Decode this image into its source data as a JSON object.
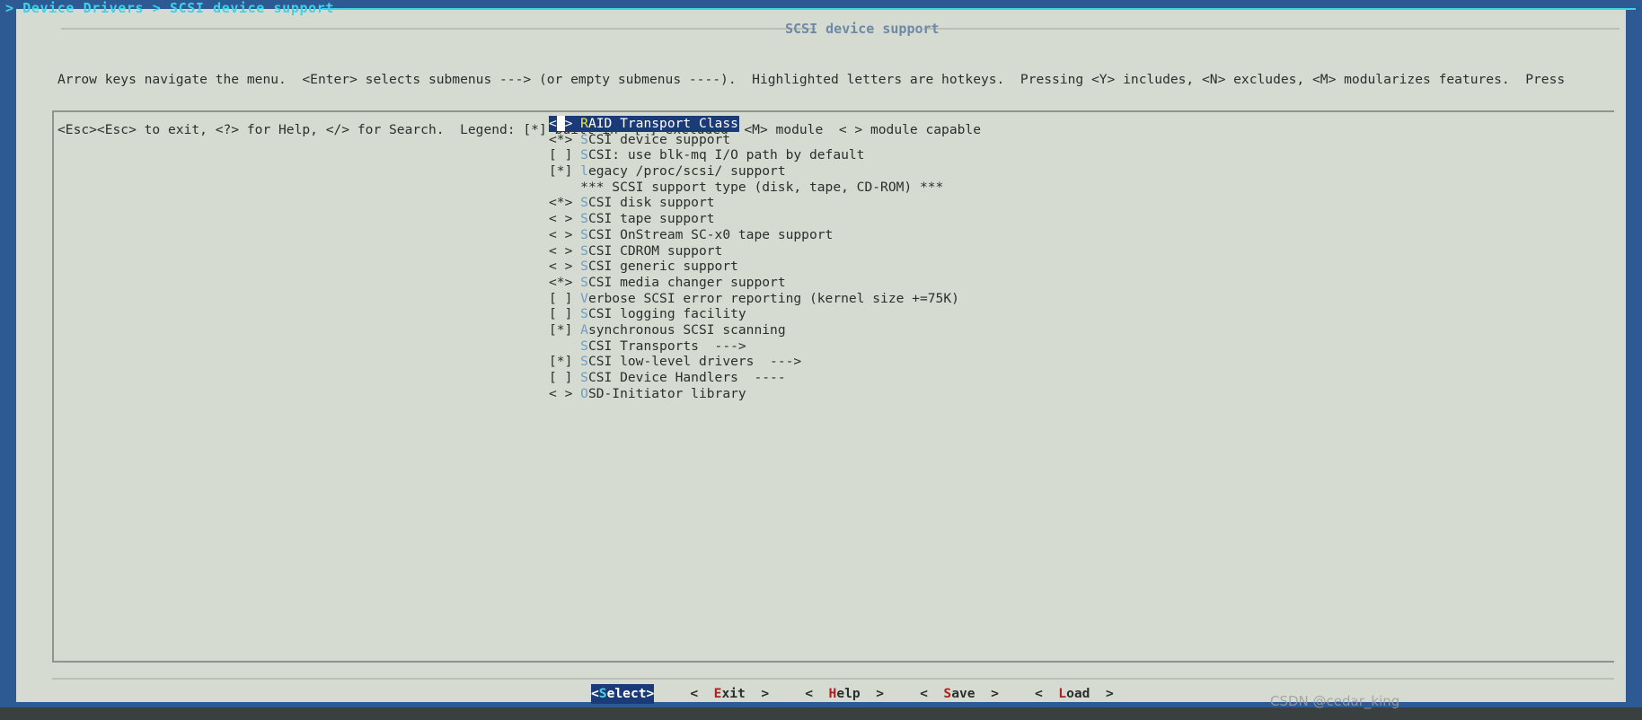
{
  "window": {
    "breadcrumb": "> Device Drivers > SCSI device support",
    "dialog_title": "SCSI device support"
  },
  "help": {
    "line1": "Arrow keys navigate the menu.  <Enter> selects submenus ---> (or empty submenus ----).  Highlighted letters are hotkeys.  Pressing <Y> includes, <N> excludes, <M> modularizes features.  Press",
    "line2": "<Esc><Esc> to exit, <?> for Help, </> for Search.  Legend: [*] built-in  [ ] excluded  <M> module  < > module capable"
  },
  "menu": {
    "selected_index": 0,
    "items": [
      {
        "state": "< >",
        "hotkey": "R",
        "rest": "AID Transport Class",
        "selected": true,
        "type": "tristate"
      },
      {
        "state": "<*>",
        "hotkey": "S",
        "rest": "CSI device support",
        "selected": false,
        "type": "tristate"
      },
      {
        "state": "[ ]",
        "hotkey": "S",
        "rest": "CSI: use blk-mq I/O path by default",
        "selected": false,
        "type": "bool"
      },
      {
        "state": "[*]",
        "hotkey": "l",
        "rest": "egacy /proc/scsi/ support",
        "selected": false,
        "type": "bool"
      },
      {
        "state": "   ",
        "hotkey": "",
        "rest": "*** SCSI support type (disk, tape, CD-ROM) ***",
        "selected": false,
        "type": "comment"
      },
      {
        "state": "<*>",
        "hotkey": "S",
        "rest": "CSI disk support",
        "selected": false,
        "type": "tristate"
      },
      {
        "state": "< >",
        "hotkey": "S",
        "rest": "CSI tape support",
        "selected": false,
        "type": "tristate"
      },
      {
        "state": "< >",
        "hotkey": "S",
        "rest": "CSI OnStream SC-x0 tape support",
        "selected": false,
        "type": "tristate"
      },
      {
        "state": "< >",
        "hotkey": "S",
        "rest": "CSI CDROM support",
        "selected": false,
        "type": "tristate"
      },
      {
        "state": "< >",
        "hotkey": "S",
        "rest": "CSI generic support",
        "selected": false,
        "type": "tristate"
      },
      {
        "state": "<*>",
        "hotkey": "S",
        "rest": "CSI media changer support",
        "selected": false,
        "type": "tristate"
      },
      {
        "state": "[ ]",
        "hotkey": "V",
        "rest": "erbose SCSI error reporting (kernel size +=75K)",
        "selected": false,
        "type": "bool"
      },
      {
        "state": "[ ]",
        "hotkey": "S",
        "rest": "CSI logging facility",
        "selected": false,
        "type": "bool"
      },
      {
        "state": "[*]",
        "hotkey": "A",
        "rest": "synchronous SCSI scanning",
        "selected": false,
        "type": "bool"
      },
      {
        "state": "   ",
        "hotkey": "S",
        "rest": "CSI Transports  --->",
        "selected": false,
        "type": "submenu"
      },
      {
        "state": "[*]",
        "hotkey": "S",
        "rest": "CSI low-level drivers  --->",
        "selected": false,
        "type": "submenu"
      },
      {
        "state": "[ ]",
        "hotkey": "S",
        "rest": "CSI Device Handlers  ----",
        "selected": false,
        "type": "submenu"
      },
      {
        "state": "< >",
        "hotkey": "O",
        "rest": "SD-Initiator library",
        "selected": false,
        "type": "tristate"
      }
    ]
  },
  "buttons": [
    {
      "prefix": "<",
      "hotkey": "S",
      "rest": "elect>",
      "suffix": "",
      "active": true,
      "name": "select"
    },
    {
      "prefix": "<  ",
      "hotkey": "E",
      "rest": "xit  ",
      "suffix": ">",
      "active": false,
      "name": "exit"
    },
    {
      "prefix": "<  ",
      "hotkey": "H",
      "rest": "elp  ",
      "suffix": ">",
      "active": false,
      "name": "help"
    },
    {
      "prefix": "<  ",
      "hotkey": "S",
      "rest": "ave  ",
      "suffix": ">",
      "active": false,
      "name": "save"
    },
    {
      "prefix": "<  ",
      "hotkey": "L",
      "rest": "oad  ",
      "suffix": ">",
      "active": false,
      "name": "load"
    }
  ],
  "watermark": "CSDN @cedar_king",
  "colors": {
    "backdrop": "#2e5a94",
    "dialog_bg": "#d6dbd2",
    "breadcrumb_text": "#3fd3e8",
    "dialog_title_text": "#6d88a8",
    "hotkey_blue": "#6f9cc4",
    "hotkey_red": "#b02020",
    "selection_bg": "#1a3a78",
    "selection_fg": "#ffffff",
    "selection_hotkey": "#e8e84a",
    "body_text": "#2b2f2b"
  }
}
